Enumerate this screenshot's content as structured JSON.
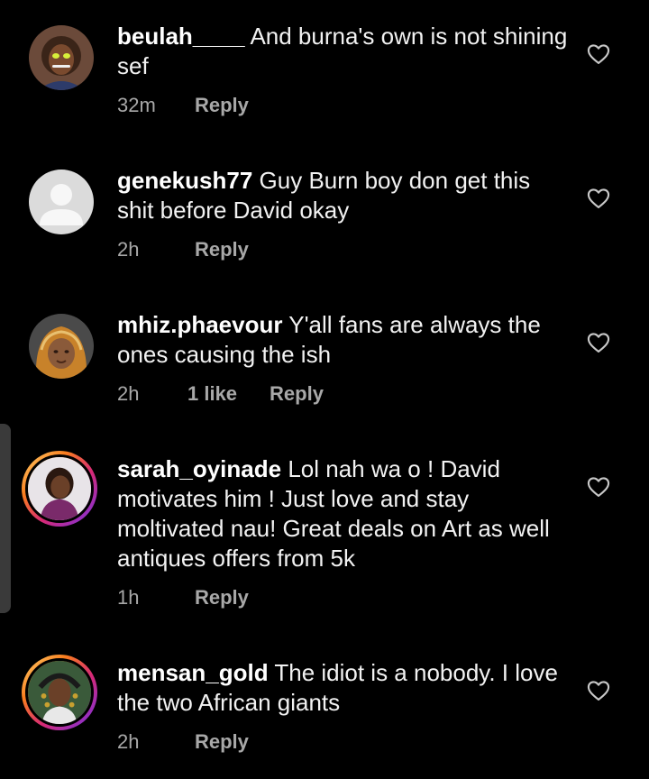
{
  "comments": [
    {
      "username": "beulah____",
      "text": "And burna's own is not shining sef",
      "time": "32m",
      "likes": "",
      "reply_label": "Reply"
    },
    {
      "username": "genekush77",
      "text": "Guy Burn boy don get this shit before David okay",
      "time": "2h",
      "likes": "",
      "reply_label": "Reply"
    },
    {
      "username": "mhiz.phaevour",
      "text": "Y'all fans are always the ones causing the ish",
      "time": "2h",
      "likes": "1 like",
      "reply_label": "Reply"
    },
    {
      "username": "sarah_oyinade",
      "text": "Lol nah wa o ! David motivates him ! Just love and stay moltivated nau! Great deals on Art as well antiques offers from 5k",
      "time": "1h",
      "likes": "",
      "reply_label": "Reply"
    },
    {
      "username": "mensan_gold",
      "text": "The idiot is a nobody. I love the two African giants",
      "time": "2h",
      "likes": "",
      "reply_label": "Reply"
    }
  ],
  "icons": {
    "like": "heart-outline-icon",
    "default_avatar": "default-avatar-icon"
  },
  "colors": {
    "background": "#000000",
    "text": "#f2f2f2",
    "meta": "#a8a8a8",
    "story_ring_start": "#feda75",
    "story_ring_end": "#962fbf"
  }
}
